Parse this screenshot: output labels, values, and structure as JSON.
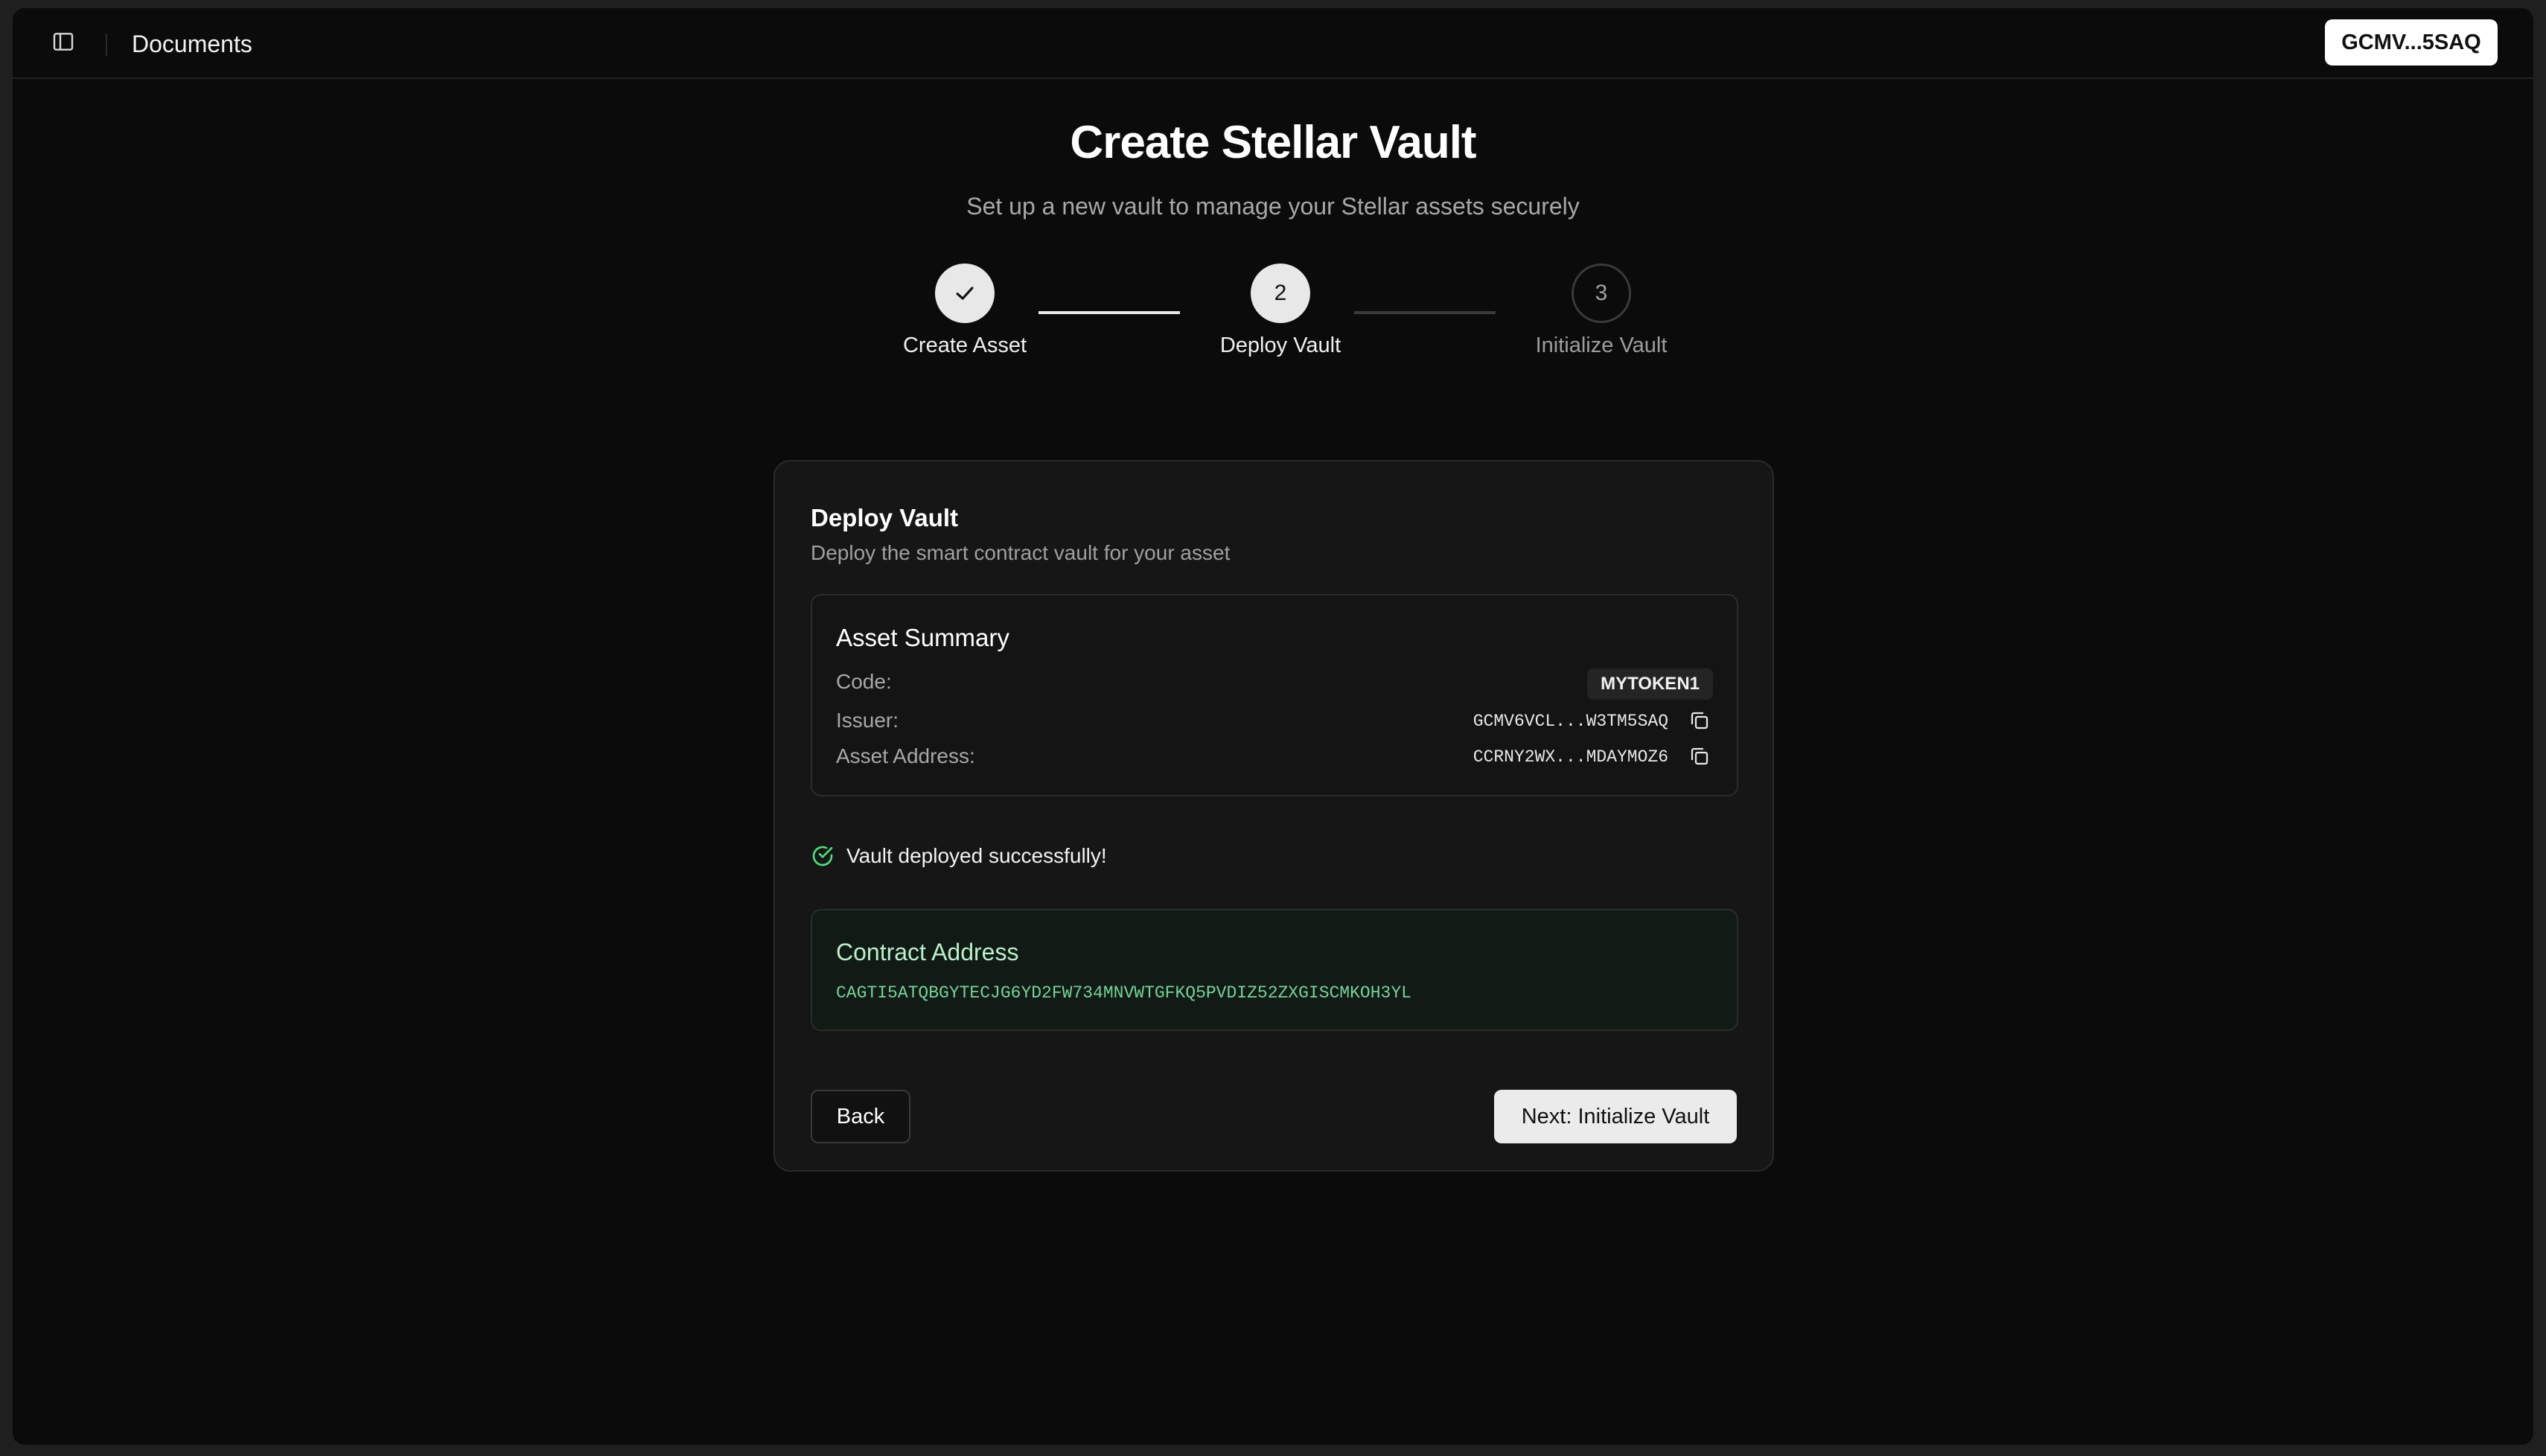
{
  "topbar": {
    "title": "Documents",
    "wallet_label": "GCMV...5SAQ"
  },
  "header": {
    "title": "Create Stellar Vault",
    "subtitle": "Set up a new vault to manage your Stellar assets securely"
  },
  "stepper": {
    "steps": [
      {
        "label": "Create Asset",
        "number": "",
        "status": "completed"
      },
      {
        "label": "Deploy Vault",
        "number": "2",
        "status": "active"
      },
      {
        "label": "Initialize Vault",
        "number": "3",
        "status": "pending"
      }
    ]
  },
  "card": {
    "title": "Deploy Vault",
    "description": "Deploy the smart contract vault for your asset",
    "summary": {
      "title": "Asset Summary",
      "code_label": "Code:",
      "code_value": "MYTOKEN1",
      "issuer_label": "Issuer:",
      "issuer_value": "GCMV6VCL...W3TM5SAQ",
      "address_label": "Asset Address:",
      "address_value": "CCRNY2WX...MDAYMOZ6"
    },
    "success_message": "Vault deployed successfully!",
    "contract": {
      "title": "Contract Address",
      "address": "CAGTI5ATQBGYTECJG6YD2FW734MNVWTGFKQ5PVDIZ52ZXGISCMKOH3YL"
    },
    "back_label": "Back",
    "next_label": "Next: Initialize Vault"
  },
  "colors": {
    "background": "#0b0b0b",
    "card": "#161616",
    "success": "#4ade80",
    "contract_text": "#74d497"
  }
}
